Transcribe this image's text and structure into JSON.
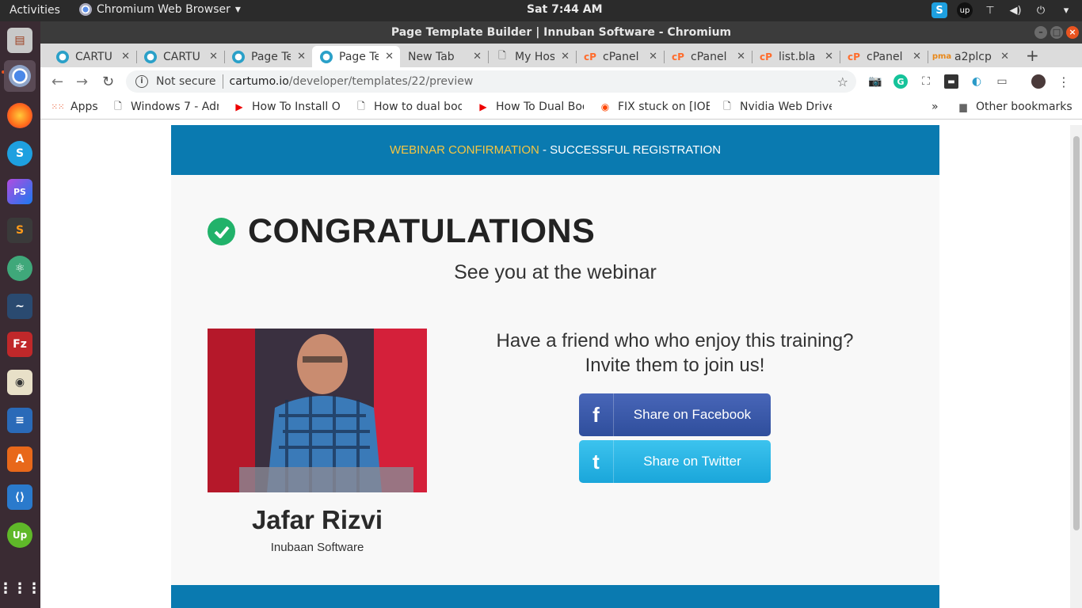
{
  "topbar": {
    "activities": "Activities",
    "app_name": "Chromium Web Browser",
    "clock": "Sat  7:44 AM"
  },
  "window": {
    "title": "Page Template Builder | Innuban Software - Chromium"
  },
  "tabs": [
    {
      "label": "CARTU",
      "icon": "cartumo-icon"
    },
    {
      "label": "CARTU",
      "icon": "cartumo-icon"
    },
    {
      "label": "Page Te",
      "icon": "cartumo-icon"
    },
    {
      "label": "Page Te",
      "icon": "cartumo-icon",
      "active": true
    },
    {
      "label": "New Tab",
      "icon": ""
    },
    {
      "label": "My Hos",
      "icon": "page-icon"
    },
    {
      "label": "cPanel",
      "icon": "cpanel-icon"
    },
    {
      "label": "cPanel",
      "icon": "cpanel-icon"
    },
    {
      "label": "list.bla",
      "icon": "cpanel-icon"
    },
    {
      "label": "cPanel",
      "icon": "cpanel-icon"
    },
    {
      "label": "a2plcp",
      "icon": "pma-icon"
    }
  ],
  "omnibox": {
    "security": "Not secure",
    "host": "cartumo.io",
    "path": "/developer/templates/22/preview"
  },
  "bookmarks": {
    "items": [
      {
        "label": "Apps",
        "icon": "apps-grid-icon"
      },
      {
        "label": "Windows 7 - Adm",
        "icon": "page-icon"
      },
      {
        "label": "How To Install O",
        "icon": "youtube-icon"
      },
      {
        "label": "How to dual boo",
        "icon": "page-icon"
      },
      {
        "label": "How To Dual Boo",
        "icon": "youtube-icon"
      },
      {
        "label": "FIX stuck on [IOE",
        "icon": "reddit-icon"
      },
      {
        "label": "Nvidia Web Drive",
        "icon": "page-icon"
      }
    ],
    "overflow": "»",
    "other": "Other bookmarks"
  },
  "page": {
    "banner_highlight": "WEBINAR CONFIRMATION",
    "banner_rest": " - SUCCESSFUL REGISTRATION",
    "heading": "CONGRATULATIONS",
    "subtitle": "See you at the webinar",
    "person_name": "Jafar Rizvi",
    "person_org": "Inubaan Software",
    "invite_line1": "Have a friend who who enjoy this training?",
    "invite_line2": "Invite them to join us!",
    "facebook_label": "Share on Facebook",
    "twitter_label": "Share on Twitter"
  },
  "colors": {
    "banner": "#0a7ab0",
    "banner_highlight": "#f4c542",
    "check": "#21b26a",
    "facebook": "#3b5ba8",
    "twitter": "#2bb4e6"
  }
}
